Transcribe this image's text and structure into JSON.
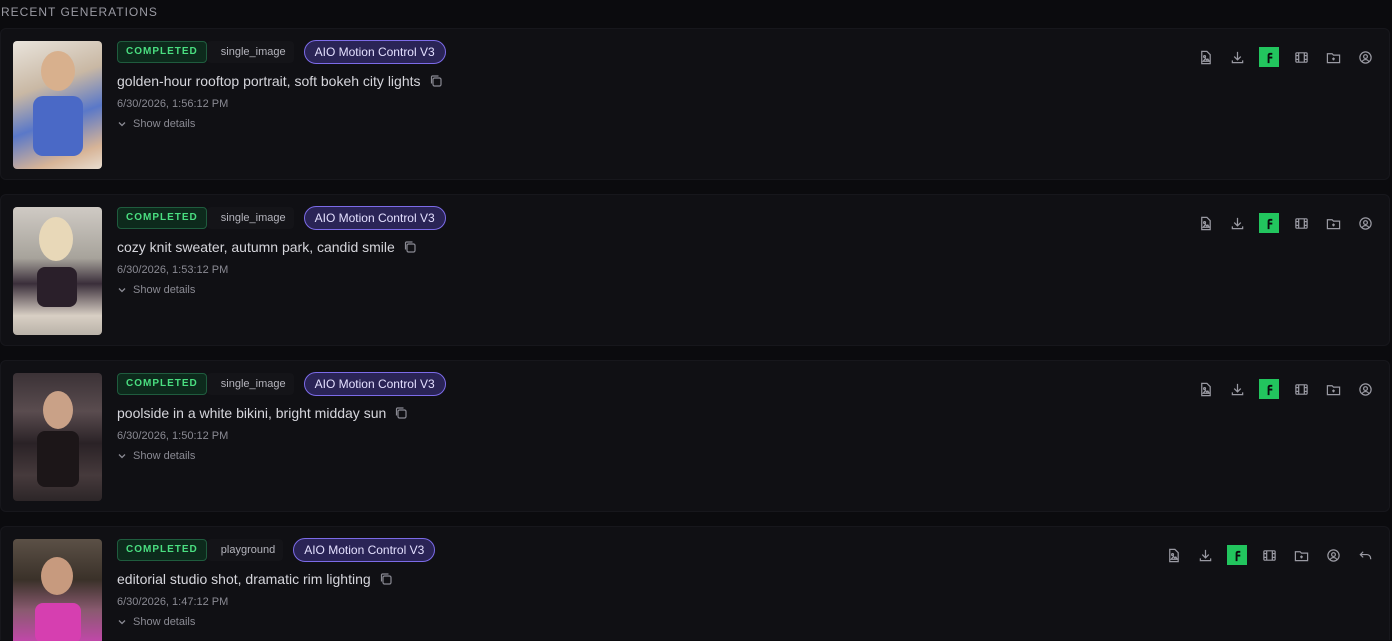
{
  "section": {
    "title": "RECENT GENERATIONS"
  },
  "cards": [
    {
      "status": "COMPLETED",
      "type": "single_image",
      "model": "AIO Motion Control V3",
      "prompt": "golden-hour rooftop portrait, soft bokeh city lights",
      "date": "6/30/2026, 1:56:12 PM",
      "details": "Show details"
    },
    {
      "status": "COMPLETED",
      "type": "single_image",
      "model": "AIO Motion Control V3",
      "prompt": "cozy knit sweater, autumn park, candid smile",
      "date": "6/30/2026, 1:53:12 PM",
      "details": "Show details"
    },
    {
      "status": "COMPLETED",
      "type": "single_image",
      "model": "AIO Motion Control V3",
      "prompt": "poolside in a white bikini, bright midday sun",
      "date": "6/30/2026, 1:50:12 PM",
      "details": "Show details"
    },
    {
      "status": "COMPLETED",
      "type": "playground",
      "model": "AIO Motion Control V3",
      "prompt": "editorial studio shot, dramatic rim lighting",
      "date": "6/30/2026, 1:47:12 PM",
      "details": "Show details"
    }
  ],
  "icons": {
    "actions": [
      "image-file-icon",
      "download-icon",
      "f-green-icon",
      "film-icon",
      "folder-icon",
      "user-circle-icon"
    ],
    "extra_action": "undo-icon"
  },
  "colors": {
    "status": "#4ade80",
    "model_badge": "#7c6be8",
    "f_badge": "#22c55e"
  }
}
